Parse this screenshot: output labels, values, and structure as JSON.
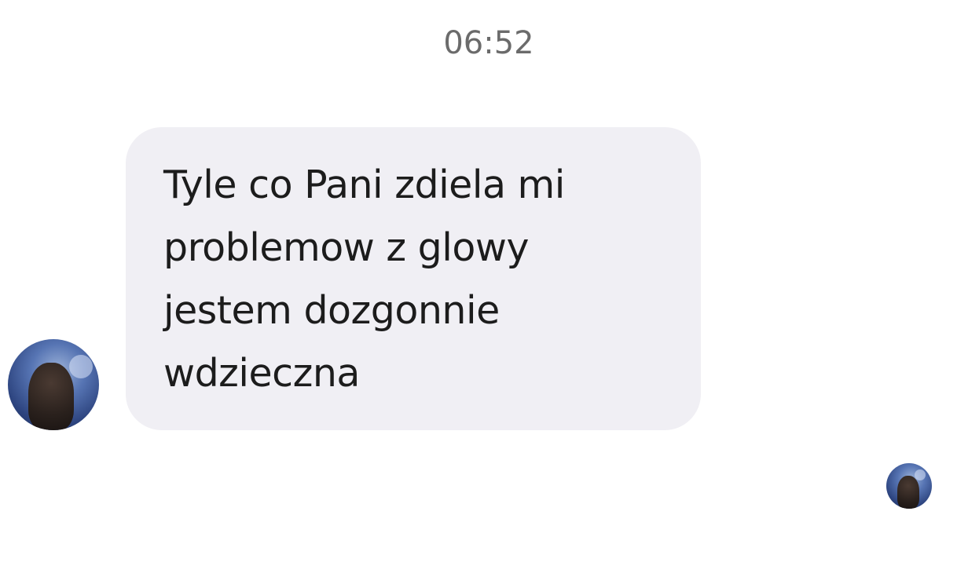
{
  "conversation": {
    "timestamp": "06:52",
    "message": {
      "text": "Tyle co Pani zdiela mi\nproblemow z glowy\njestem dozgonnie\nwdzieczna"
    },
    "sender_avatar": "profile-photo",
    "read_receipt_avatar": "profile-photo"
  },
  "colors": {
    "background": "#ffffff",
    "bubble": "#f0eff4",
    "timestamp": "#6b6b6b",
    "text": "#1c1c1c"
  }
}
